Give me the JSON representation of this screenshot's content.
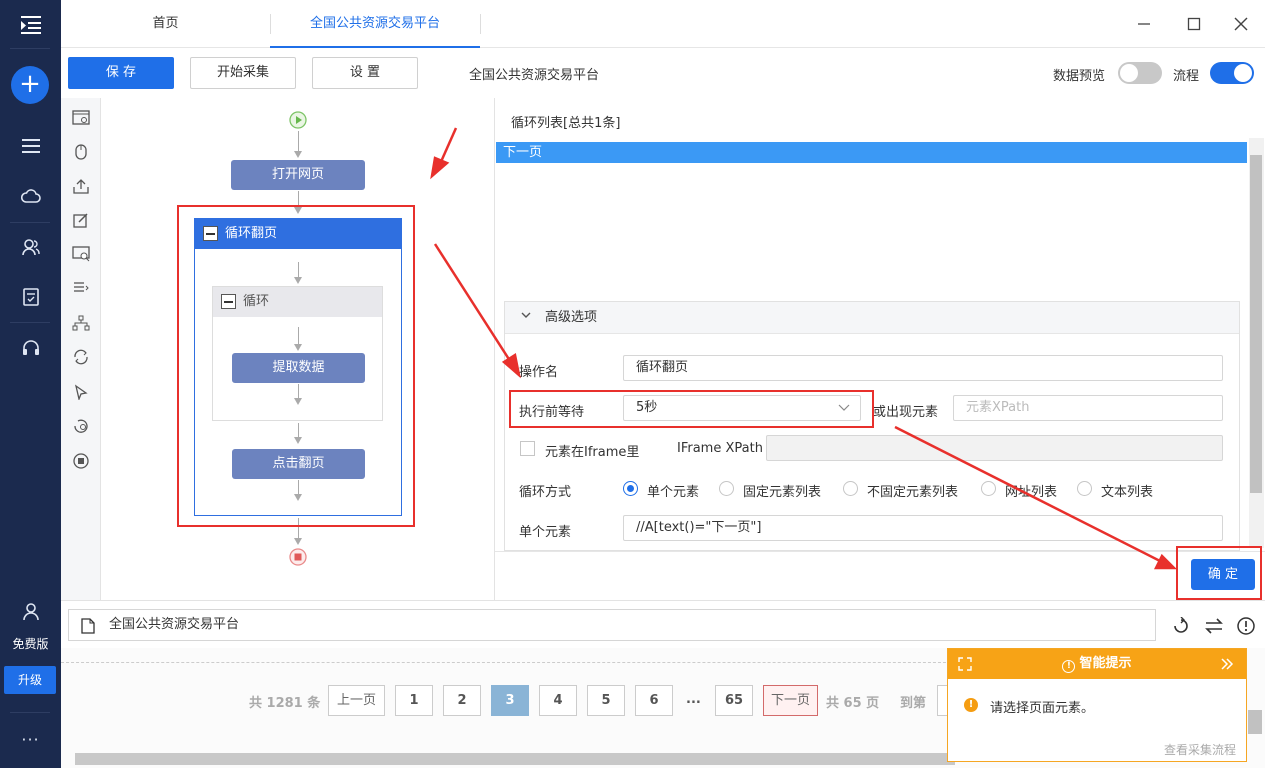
{
  "tabs": {
    "home": "首页",
    "platform": "全国公共资源交易平台"
  },
  "toolbar": {
    "save": "保 存",
    "start": "开始采集",
    "settings": "设 置",
    "title": "全国公共资源交易平台",
    "preview_label": "数据预览",
    "flow_label": "流程"
  },
  "rail": {
    "free_label": "免费版",
    "upgrade_label": "升级",
    "more": "···"
  },
  "flow": {
    "open_page": "打开网页",
    "loop_page": "循环翻页",
    "loop": "循环",
    "extract": "提取数据",
    "click_page": "点击翻页"
  },
  "panel": {
    "list_head": "循环列表[总共1条]",
    "list_items": [
      "下一页"
    ],
    "advanced": "高级选项",
    "op_name_label": "操作名",
    "op_name_value": "循环翻页",
    "wait_label": "执行前等待",
    "wait_value": "5秒",
    "appear_label": "或出现元素",
    "appear_placeholder": "元素XPath",
    "iframe_label": "元素在Iframe里",
    "iframe_xpath_label": "IFrame XPath",
    "loop_mode_label": "循环方式",
    "loop_modes": [
      "单个元素",
      "固定元素列表",
      "不固定元素列表",
      "网址列表",
      "文本列表"
    ],
    "single_label": "单个元素",
    "single_value": "//A[text()=\"下一页\"]",
    "ok": "确 定"
  },
  "urlbar": {
    "url": "全国公共资源交易平台"
  },
  "pager": {
    "total": "共 1281 条",
    "prev": "上一页",
    "pages": [
      "1",
      "2",
      "3",
      "4",
      "5",
      "6"
    ],
    "ellipsis": "...",
    "last": "65",
    "next": "下一页",
    "total_pages": "共 65 页",
    "goto": "到第"
  },
  "tip": {
    "title": "智能提示",
    "message": "请选择页面元素。",
    "link": "查看采集流程"
  },
  "colors": {
    "accent": "#1f6fe8",
    "rail": "#1b2a4e",
    "annotation": "#e8302c",
    "tip": "#f7a316"
  }
}
